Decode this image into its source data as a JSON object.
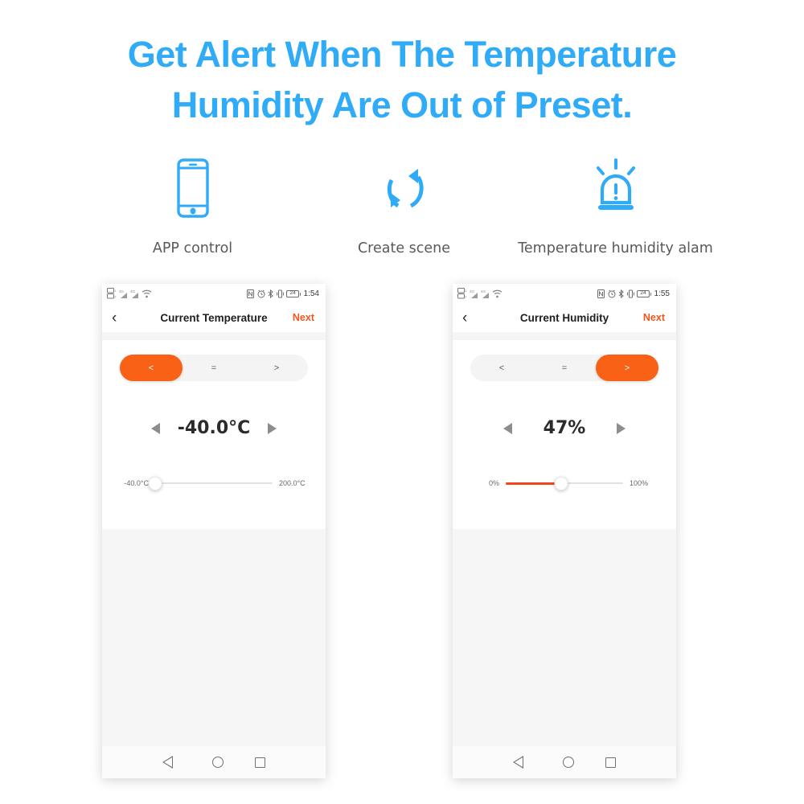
{
  "headline": {
    "line1": "Get Alert When The Temperature",
    "line2": "Humidity Are Out of Preset.",
    "color": "#2FABF7"
  },
  "features": [
    {
      "icon": "phone-app-icon",
      "label": "APP control"
    },
    {
      "icon": "sync-refresh-icon",
      "label": "Create scene"
    },
    {
      "icon": "alarm-siren-icon",
      "label": "Temperature humidity alam"
    }
  ],
  "colors": {
    "accent_blue": "#2FABF7",
    "accent_orange": "#F96117",
    "slider_fill": "#F4441A",
    "next_link": "#F9551B",
    "grey_body": "#f6f6f6"
  },
  "phones": [
    {
      "name": "temperature-screen",
      "status_bar": {
        "time": "1:54",
        "battery_level": "24",
        "left_icons": [
          "sim-card-icon",
          "sim-card-icon",
          "signal-bars-icon",
          "signal-bars-icon",
          "wifi-icon"
        ],
        "right_icons": [
          "nfc-icon",
          "alarm-clock-icon",
          "bluetooth-icon",
          "vibrate-icon",
          "battery-icon"
        ]
      },
      "appbar": {
        "back": "‹",
        "title": "Current Temperature",
        "next": "Next"
      },
      "segments": [
        {
          "label": "<",
          "active": true
        },
        {
          "label": "=",
          "active": false
        },
        {
          "label": ">",
          "active": false
        }
      ],
      "value": "-40.0°C",
      "slider": {
        "min_label": "-40.0°C",
        "max_label": "200.0°C",
        "percent": 0
      }
    },
    {
      "name": "humidity-screen",
      "status_bar": {
        "time": "1:55",
        "battery_level": "24",
        "left_icons": [
          "sim-card-icon",
          "sim-card-icon",
          "signal-bars-icon",
          "signal-bars-icon",
          "wifi-icon"
        ],
        "right_icons": [
          "nfc-icon",
          "alarm-clock-icon",
          "bluetooth-icon",
          "vibrate-icon",
          "battery-icon"
        ]
      },
      "appbar": {
        "back": "‹",
        "title": "Current Humidity",
        "next": "Next"
      },
      "segments": [
        {
          "label": "<",
          "active": false
        },
        {
          "label": "=",
          "active": false
        },
        {
          "label": ">",
          "active": true
        }
      ],
      "value": "47%",
      "slider": {
        "min_label": "0%",
        "max_label": "100%",
        "percent": 47
      }
    }
  ],
  "nav_bar": {
    "back": "nav-back-icon",
    "home": "nav-home-icon",
    "recents": "nav-recents-icon"
  }
}
